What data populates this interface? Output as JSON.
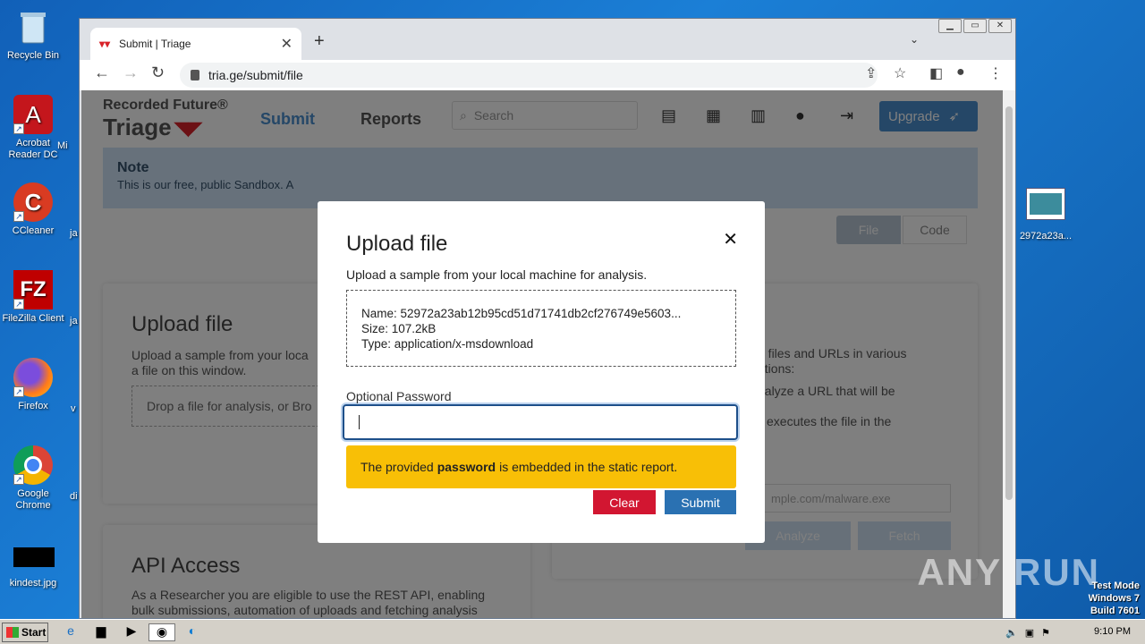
{
  "desktop": {
    "icons": [
      {
        "label": "Recycle Bin"
      },
      {
        "label": "Acrobat Reader DC"
      },
      {
        "label": "CCleaner"
      },
      {
        "label": "FileZilla Client"
      },
      {
        "label": "Firefox"
      },
      {
        "label": "Google Chrome"
      },
      {
        "label": "kindest.jpg"
      }
    ],
    "partial_labels": [
      "Mi",
      "ja",
      "ja",
      "v",
      "di"
    ],
    "right_file": "2972a23a...",
    "test_mode": [
      "Test Mode",
      "Windows 7",
      "Build 7601"
    ],
    "watermark": "ANY RUN"
  },
  "browser": {
    "tab_title": "Submit | Triage",
    "url": "tria.ge/submit/file",
    "new_tab": "+",
    "tab_close": "✕",
    "nav_back": "←",
    "nav_forward": "→",
    "nav_reload": "↻"
  },
  "page": {
    "logo_top": "Recorded Future®",
    "logo_bottom": "Triage",
    "nav": {
      "submit": "Submit",
      "reports": "Reports"
    },
    "search_placeholder": "Search",
    "upgrade": "Upgrade",
    "note": {
      "heading": "Note",
      "text": "This is our free, public Sandbox. A"
    },
    "toggle": {
      "file": "File",
      "code": "Code"
    },
    "upload_card": {
      "title": "Upload file",
      "text1": "Upload a sample from your loca",
      "text2": "a file on this window.",
      "drop": "Drop a file for analysis, or Bro"
    },
    "right_card": {
      "line1": "e files and URLs in various",
      "line2": "ptions:",
      "line3": "nalyze a URL that will be",
      "line4": "executes the file in the",
      "url_placeholder": "mple.com/malware.exe",
      "analyze": "Analyze",
      "fetch": "Fetch"
    },
    "api_card": {
      "title": "API Access",
      "text": "As a Researcher you are eligible to use the REST API, enabling bulk submissions, automation of uploads and fetching analysis data, and full integration with other tools. For more information"
    }
  },
  "modal": {
    "title": "Upload file",
    "close": "✕",
    "subtitle": "Upload a sample from your local machine for analysis.",
    "file_name": "Name: 52972a23ab12b95cd51d71741db2cf276749e5603...",
    "file_size": "Size: 107.2kB",
    "file_type": "Type: application/x-msdownload",
    "password_label": "Optional Password",
    "password_value": "",
    "warning_pre": "The provided",
    "warning_bold": "password",
    "warning_post": "is embedded in the static report.",
    "clear": "Clear",
    "submit": "Submit"
  },
  "taskbar": {
    "start": "Start",
    "clock": "9:10 PM"
  }
}
